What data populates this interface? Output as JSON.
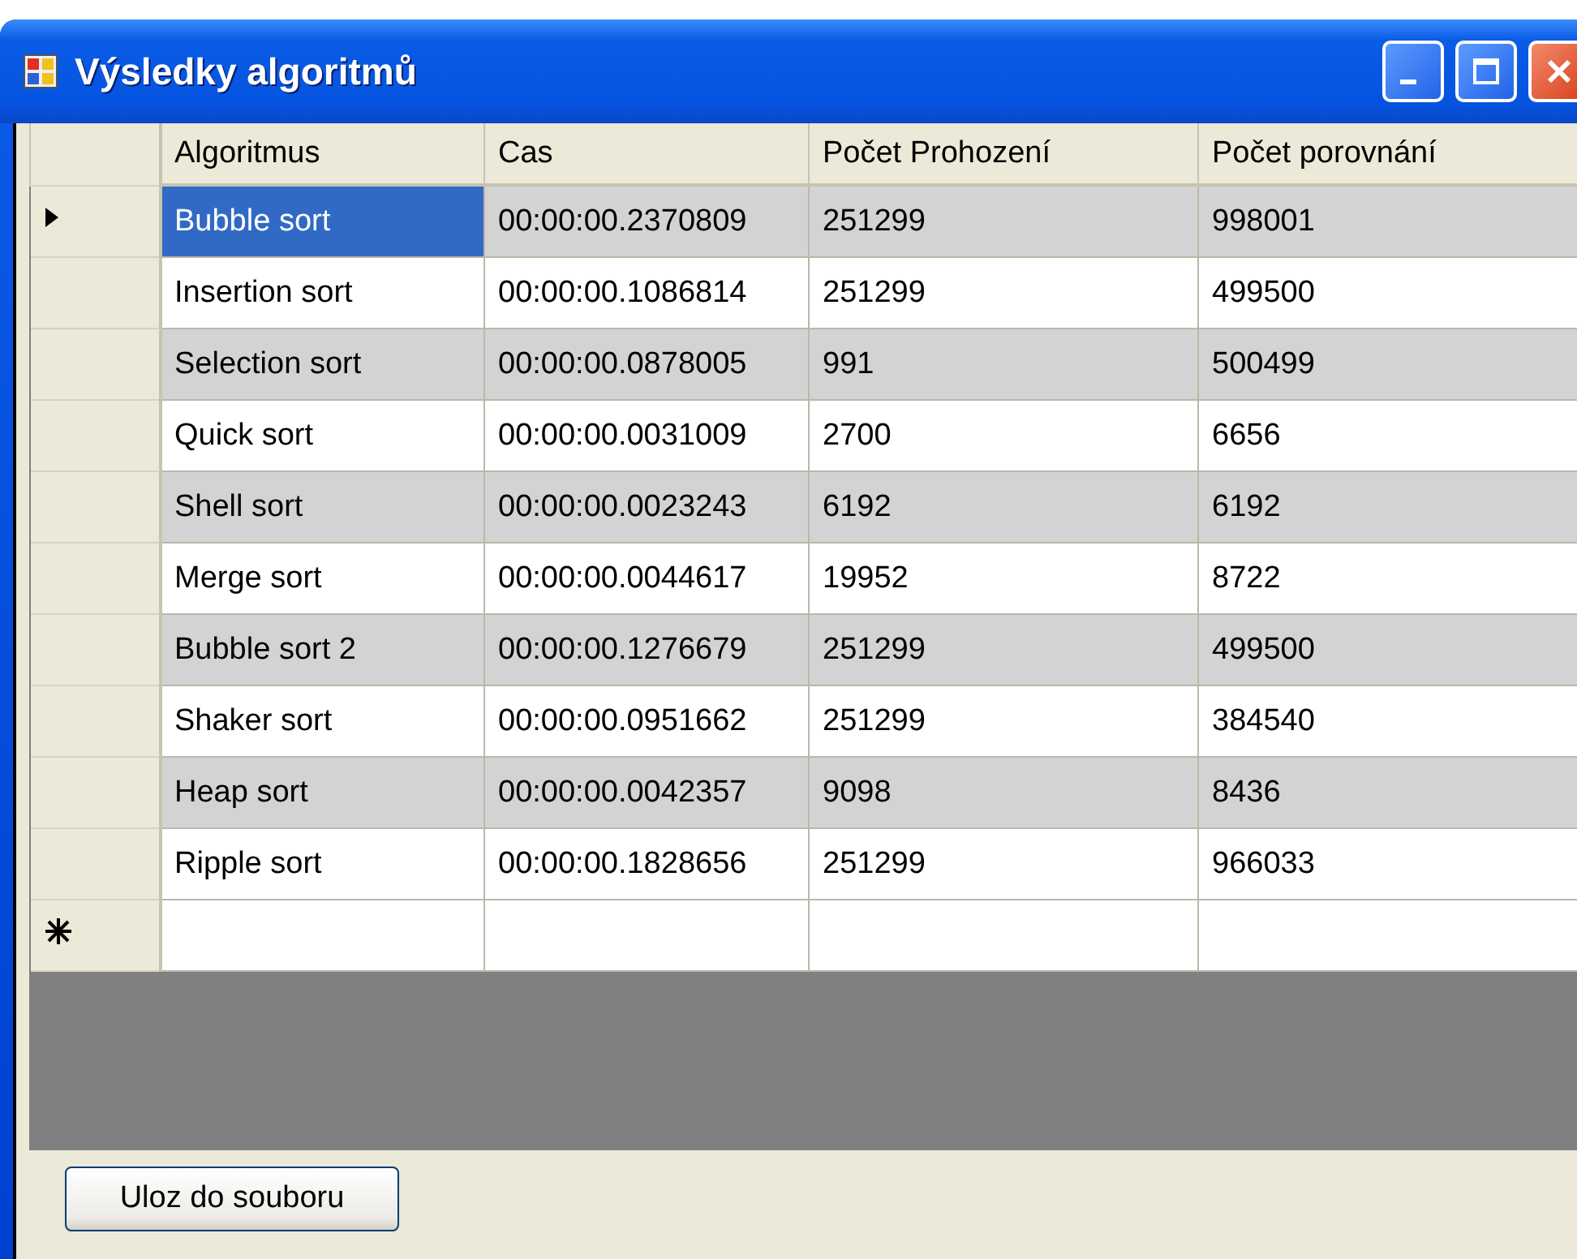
{
  "window": {
    "title": "Výsledky algoritmů"
  },
  "table": {
    "columns": [
      "Algoritmus",
      "Cas",
      "Počet Prohození",
      "Počet porovnání"
    ],
    "rows": [
      {
        "selected": true,
        "cells": [
          "Bubble sort",
          "00:00:00.2370809",
          "251299",
          "998001"
        ]
      },
      {
        "selected": false,
        "cells": [
          "Insertion sort",
          "00:00:00.1086814",
          "251299",
          "499500"
        ]
      },
      {
        "selected": false,
        "cells": [
          "Selection sort",
          "00:00:00.0878005",
          "991",
          "500499"
        ]
      },
      {
        "selected": false,
        "cells": [
          "Quick sort",
          "00:00:00.0031009",
          "2700",
          "6656"
        ]
      },
      {
        "selected": false,
        "cells": [
          "Shell sort",
          "00:00:00.0023243",
          "6192",
          "6192"
        ]
      },
      {
        "selected": false,
        "cells": [
          "Merge sort",
          "00:00:00.0044617",
          "19952",
          "8722"
        ]
      },
      {
        "selected": false,
        "cells": [
          "Bubble sort 2",
          "00:00:00.1276679",
          "251299",
          "499500"
        ]
      },
      {
        "selected": false,
        "cells": [
          "Shaker sort",
          "00:00:00.0951662",
          "251299",
          "384540"
        ]
      },
      {
        "selected": false,
        "cells": [
          "Heap sort",
          "00:00:00.0042357",
          "9098",
          "8436"
        ]
      },
      {
        "selected": false,
        "cells": [
          "Ripple sort",
          "00:00:00.1828656",
          "251299",
          "966033"
        ]
      }
    ]
  },
  "buttons": [
    "Uloz do souboru"
  ]
}
